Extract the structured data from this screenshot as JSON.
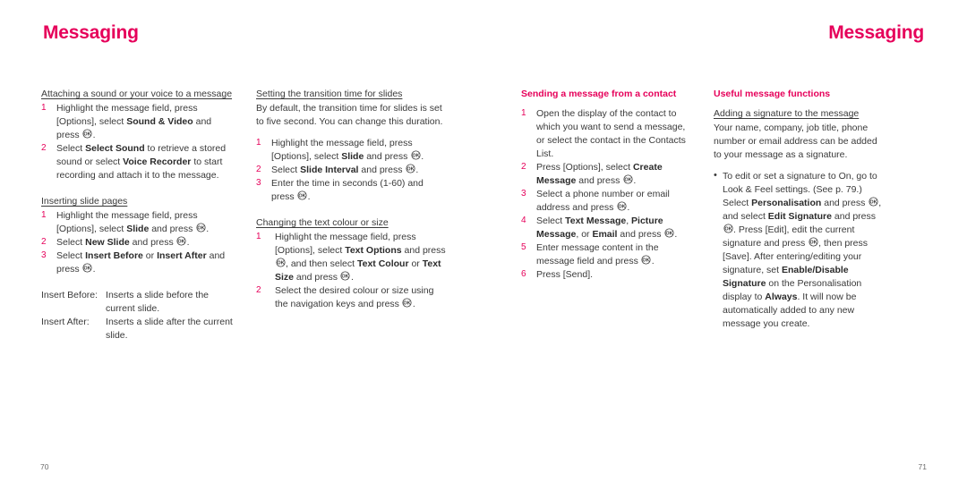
{
  "document": {
    "running_head_left": "Messaging",
    "running_head_right": "Messaging",
    "folio_left": "70",
    "folio_right": "71",
    "accent_color": "#E6005A",
    "text_color": "#3a3a3a",
    "ok_key_icon": "ok-key-icon"
  },
  "col1": {
    "heading1": "Attaching a sound or your voice to a message",
    "steps1": [
      {
        "num": "1",
        "html": "Highlight the message field, press [Options], select <b>Sound &amp; Video</b> and press <OK>."
      },
      {
        "num": "2",
        "html": "Select <b>Select Sound</b> to retrieve a stored sound or select <b>Voice Recorder</b> to start recording and attach it to the message."
      }
    ],
    "heading2": "Inserting slide pages",
    "steps2": [
      {
        "num": "1",
        "html": "Highlight the message field, press [Options], select <b>Slide</b> and press <OK>."
      },
      {
        "num": "2",
        "html": "Select <b>New Slide</b> and press <OK>."
      },
      {
        "num": "3",
        "html": "Select <b>Insert Before</b> or <b>Insert After</b> and press <OK>."
      }
    ],
    "definitions": [
      {
        "term": "Insert Before:",
        "desc": "Inserts a slide before the current slide."
      },
      {
        "term": "Insert After:",
        "desc": "Inserts a slide after the current slide."
      }
    ]
  },
  "col2": {
    "heading1": "Setting the transition time for slides",
    "intro": "By default, the transition time for slides is set to five second. You can change this duration.",
    "steps1": [
      {
        "num": "1",
        "html": "Highlight the message field, press [Options], select <b>Slide</b> and press <OK>."
      },
      {
        "num": "2",
        "html": "Select <b>Slide Interval</b> and press <OK>."
      },
      {
        "num": "3",
        "html": "Enter the time in seconds (1-60) and press <OK>."
      }
    ],
    "heading2": "Changing the text colour or size",
    "steps2": [
      {
        "num": "1",
        "html": "Highlight the message field, press [Options], select <b>Text Options</b> and press <OK>, and then select <b>Text Colour</b> or <b>Text Size</b> and press <OK>."
      },
      {
        "num": "2",
        "html": "Select the desired colour or size using the navigation keys and press <OK>."
      }
    ]
  },
  "col3": {
    "heading1": "Sending a message from a contact",
    "steps1": [
      {
        "num": "1",
        "html": "Open the display of the contact to which you want to send a message, or select the contact in the Contacts List."
      },
      {
        "num": "2",
        "html": "Press [Options], select <b>Create Message</b> and press <OK>."
      },
      {
        "num": "3",
        "html": "Select a phone number or email address and press <OK>."
      },
      {
        "num": "4",
        "html": "Select <b>Text Message</b>, <b>Picture Message</b>, or <b>Email</b> and press <OK>."
      },
      {
        "num": "5",
        "html": "Enter message content in the message field and press <OK>."
      },
      {
        "num": "6",
        "html": "Press [Send]."
      }
    ]
  },
  "col4": {
    "heading1": "Useful message functions",
    "heading2": "Adding a signature to the message",
    "intro": "Your name, company, job title, phone number or email address can be added to your message as a signature.",
    "bullets": [
      {
        "html": "To edit or set a signature to On, go to Look &amp; Feel settings. (See p. 79.) Select <b>Personalisation</b> and press <OK>, and select <b>Edit Signature</b> and press <OK>. Press [Edit], edit the current signature and press <OK>, then press [Save]. After entering/editing your signature, set <b>Enable/Disable Signature</b> on the Personalisation display to <b>Always</b>. It will now be automatically added to any new message you create."
      }
    ]
  }
}
